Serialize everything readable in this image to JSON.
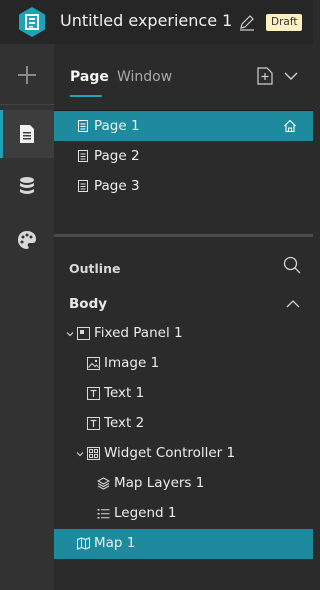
{
  "header": {
    "title": "Untitled experience 1",
    "badge": "Draft",
    "brand_color": "#1ea2b8"
  },
  "sidebar_rail": {
    "items": [
      {
        "icon": "plus-icon",
        "active": false
      },
      {
        "icon": "page-icon",
        "active": true
      },
      {
        "icon": "data-icon",
        "active": false
      },
      {
        "icon": "palette-icon",
        "active": false
      }
    ]
  },
  "page_panel": {
    "tabs": [
      {
        "label": "Page",
        "active": true
      },
      {
        "label": "Window",
        "active": false
      }
    ],
    "pages": [
      {
        "label": "Page 1",
        "selected": true,
        "is_home": true
      },
      {
        "label": "Page 2",
        "selected": false
      },
      {
        "label": "Page 3",
        "selected": false
      }
    ]
  },
  "outline": {
    "title": "Outline",
    "root_label": "Body",
    "items": [
      {
        "label": "Fixed Panel 1",
        "icon": "fixed-panel-icon",
        "level": 0,
        "expanded": true
      },
      {
        "label": "Image 1",
        "icon": "image-icon",
        "level": 1
      },
      {
        "label": "Text 1",
        "icon": "text-icon",
        "level": 1
      },
      {
        "label": "Text 2",
        "icon": "text-icon",
        "level": 1
      },
      {
        "label": "Widget Controller 1",
        "icon": "widget-controller-icon",
        "level": 1,
        "expanded": true
      },
      {
        "label": "Map Layers 1",
        "icon": "layers-icon",
        "level": 2
      },
      {
        "label": "Legend 1",
        "icon": "legend-icon",
        "level": 2
      },
      {
        "label": "Map 1",
        "icon": "map-icon",
        "level": 0,
        "selected": true
      }
    ]
  }
}
